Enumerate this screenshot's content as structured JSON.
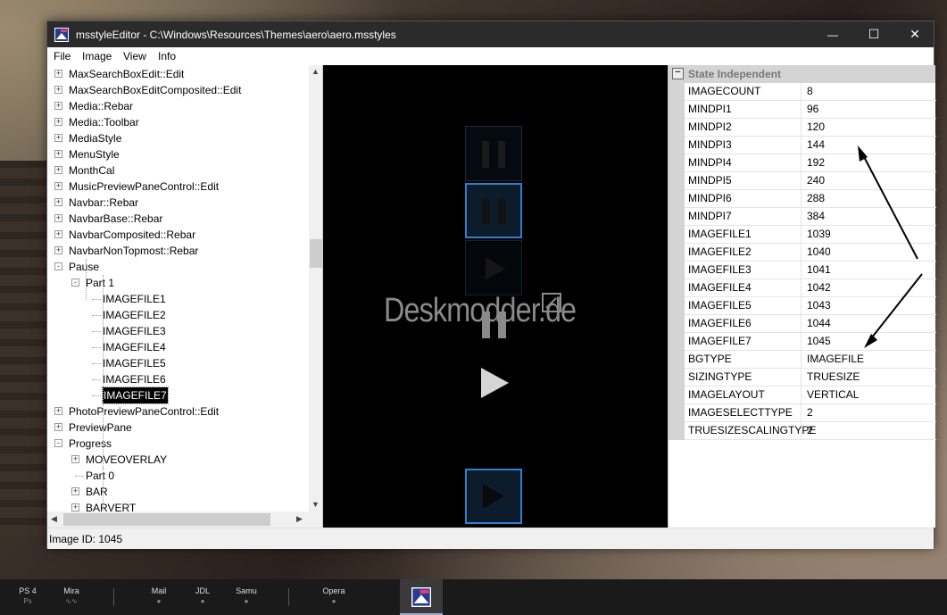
{
  "window": {
    "title": "msstyleEditor - C:\\Windows\\Resources\\Themes\\aero\\aero.msstyles",
    "controls": {
      "minimize": "—",
      "maximize": "☐",
      "close": "✕"
    }
  },
  "menu": [
    "File",
    "Image",
    "View",
    "Info"
  ],
  "tree": {
    "items": [
      {
        "label": "MaxSearchBoxEdit::Edit",
        "exp": "+"
      },
      {
        "label": "MaxSearchBoxEditComposited::Edit",
        "exp": "+"
      },
      {
        "label": "Media::Rebar",
        "exp": "+"
      },
      {
        "label": "Media::Toolbar",
        "exp": "+"
      },
      {
        "label": "MediaStyle",
        "exp": "+"
      },
      {
        "label": "MenuStyle",
        "exp": "+"
      },
      {
        "label": "MonthCal",
        "exp": "+"
      },
      {
        "label": "MusicPreviewPaneControl::Edit",
        "exp": "+"
      },
      {
        "label": "Navbar::Rebar",
        "exp": "+"
      },
      {
        "label": "NavbarBase::Rebar",
        "exp": "+"
      },
      {
        "label": "NavbarComposited::Rebar",
        "exp": "+"
      },
      {
        "label": "NavbarNonTopmost::Rebar",
        "exp": "+"
      },
      {
        "label": "Pause",
        "exp": "-"
      },
      {
        "label": "Part 1",
        "exp": "-"
      },
      {
        "label": "IMAGEFILE1"
      },
      {
        "label": "IMAGEFILE2"
      },
      {
        "label": "IMAGEFILE3"
      },
      {
        "label": "IMAGEFILE4"
      },
      {
        "label": "IMAGEFILE5"
      },
      {
        "label": "IMAGEFILE6"
      },
      {
        "label": "IMAGEFILE7"
      },
      {
        "label": "PhotoPreviewPaneControl::Edit",
        "exp": "+"
      },
      {
        "label": "PreviewPane",
        "exp": "+"
      },
      {
        "label": "Progress",
        "exp": "-"
      },
      {
        "label": "MOVEOVERLAY",
        "exp": "+"
      },
      {
        "label": "Part 0"
      },
      {
        "label": "BAR",
        "exp": "+"
      },
      {
        "label": "BARVERT",
        "exp": "+"
      }
    ]
  },
  "preview": {
    "watermark": "Deskmodder.de"
  },
  "properties": {
    "section": "State Independent",
    "section_toggle": "−",
    "rows": [
      {
        "name": "IMAGECOUNT",
        "value": "8"
      },
      {
        "name": "MINDPI1",
        "value": "96"
      },
      {
        "name": "MINDPI2",
        "value": "120"
      },
      {
        "name": "MINDPI3",
        "value": "144"
      },
      {
        "name": "MINDPI4",
        "value": "192"
      },
      {
        "name": "MINDPI5",
        "value": "240"
      },
      {
        "name": "MINDPI6",
        "value": "288"
      },
      {
        "name": "MINDPI7",
        "value": "384"
      },
      {
        "name": "IMAGEFILE1",
        "value": "1039"
      },
      {
        "name": "IMAGEFILE2",
        "value": "1040"
      },
      {
        "name": "IMAGEFILE3",
        "value": "1041"
      },
      {
        "name": "IMAGEFILE4",
        "value": "1042"
      },
      {
        "name": "IMAGEFILE5",
        "value": "1043"
      },
      {
        "name": "IMAGEFILE6",
        "value": "1044"
      },
      {
        "name": "IMAGEFILE7",
        "value": "1045"
      },
      {
        "name": "BGTYPE",
        "value": "IMAGEFILE"
      },
      {
        "name": "SIZINGTYPE",
        "value": "TRUESIZE"
      },
      {
        "name": "IMAGELAYOUT",
        "value": "VERTICAL"
      },
      {
        "name": "IMAGESELECTTYPE",
        "value": "2"
      },
      {
        "name": "TRUESIZESCALINGTYPE",
        "value": "2"
      }
    ]
  },
  "status": {
    "text": "Image ID: 1045"
  },
  "taskbar": [
    {
      "label": "PS 4",
      "sub": "Ps"
    },
    {
      "label": "Mira",
      "sub": "∿∿"
    },
    {
      "label": "Mail",
      "sub": "●"
    },
    {
      "label": "JDL",
      "sub": "●"
    },
    {
      "label": "Samu",
      "sub": "●"
    },
    {
      "label": "Opera",
      "sub": "●"
    }
  ],
  "colors": {
    "accent": "#3a8ee6",
    "titlebar": "#2b2b2b",
    "preview_bg": "#000000"
  }
}
